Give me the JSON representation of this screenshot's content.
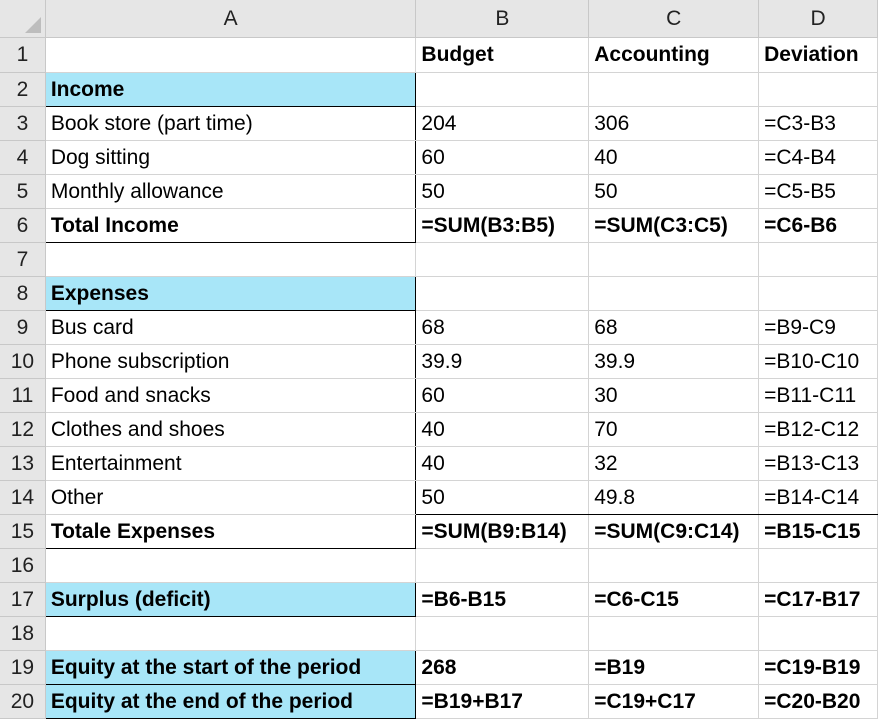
{
  "columns": [
    "A",
    "B",
    "C",
    "D"
  ],
  "colors": {
    "highlight": "#a8e6f8",
    "header_bg": "#e6e6e6"
  },
  "rows": [
    {
      "n": "1",
      "a": "",
      "b": "Budget",
      "c": "Accounting",
      "d": "Deviation",
      "bold": true,
      "blue": false
    },
    {
      "n": "2",
      "a": "Income",
      "b": "",
      "c": "",
      "d": "",
      "bold": true,
      "blue": true
    },
    {
      "n": "3",
      "a": "Book store (part time)",
      "b": "204",
      "c": "306",
      "d": "=C3-B3",
      "bold": false,
      "blue": false
    },
    {
      "n": "4",
      "a": "Dog sitting",
      "b": "60",
      "c": "40",
      "d": "=C4-B4",
      "bold": false,
      "blue": false
    },
    {
      "n": "5",
      "a": "Monthly allowance",
      "b": "50",
      "c": "50",
      "d": "=C5-B5",
      "bold": false,
      "blue": false
    },
    {
      "n": "6",
      "a": "Total Income",
      "b": "=SUM(B3:B5)",
      "c": "=SUM(C3:C5)",
      "d": "=C6-B6",
      "bold": true,
      "blue": false
    },
    {
      "n": "7",
      "a": "",
      "b": "",
      "c": "",
      "d": "",
      "bold": false,
      "blue": false
    },
    {
      "n": "8",
      "a": "Expenses",
      "b": "",
      "c": "",
      "d": "",
      "bold": true,
      "blue": true
    },
    {
      "n": "9",
      "a": "Bus card",
      "b": "68",
      "c": "68",
      "d": "=B9-C9",
      "bold": false,
      "blue": false
    },
    {
      "n": "10",
      "a": "Phone subscription",
      "b": "39.9",
      "c": "39.9",
      "d": "=B10-C10",
      "bold": false,
      "blue": false
    },
    {
      "n": "11",
      "a": "Food and snacks",
      "b": "60",
      "c": "30",
      "d": "=B11-C11",
      "bold": false,
      "blue": false
    },
    {
      "n": "12",
      "a": "Clothes and shoes",
      "b": "40",
      "c": "70",
      "d": "=B12-C12",
      "bold": false,
      "blue": false
    },
    {
      "n": "13",
      "a": "Entertainment",
      "b": "40",
      "c": "32",
      "d": "=B13-C13",
      "bold": false,
      "blue": false
    },
    {
      "n": "14",
      "a": "Other",
      "b": "50",
      "c": "49.8",
      "d": "=B14-C14",
      "bold": false,
      "blue": false
    },
    {
      "n": "15",
      "a": "Totale Expenses",
      "b": "=SUM(B9:B14)",
      "c": "=SUM(C9:C14)",
      "d": "=B15-C15",
      "bold": true,
      "blue": false
    },
    {
      "n": "16",
      "a": "",
      "b": "",
      "c": "",
      "d": "",
      "bold": false,
      "blue": false
    },
    {
      "n": "17",
      "a": "Surplus (deficit)",
      "b": "=B6-B15",
      "c": "=C6-C15",
      "d": "=C17-B17",
      "bold": true,
      "blue": true
    },
    {
      "n": "18",
      "a": "",
      "b": "",
      "c": "",
      "d": "",
      "bold": false,
      "blue": false
    },
    {
      "n": "19",
      "a": "Equity at the start of the period",
      "b": "268",
      "c": "=B19",
      "d": "=C19-B19",
      "bold": true,
      "blue": true
    },
    {
      "n": "20",
      "a": "Equity at the end of the period",
      "b": "=B19+B17",
      "c": "=C19+C17",
      "d": "=C20-B20",
      "bold": true,
      "blue": true
    }
  ]
}
